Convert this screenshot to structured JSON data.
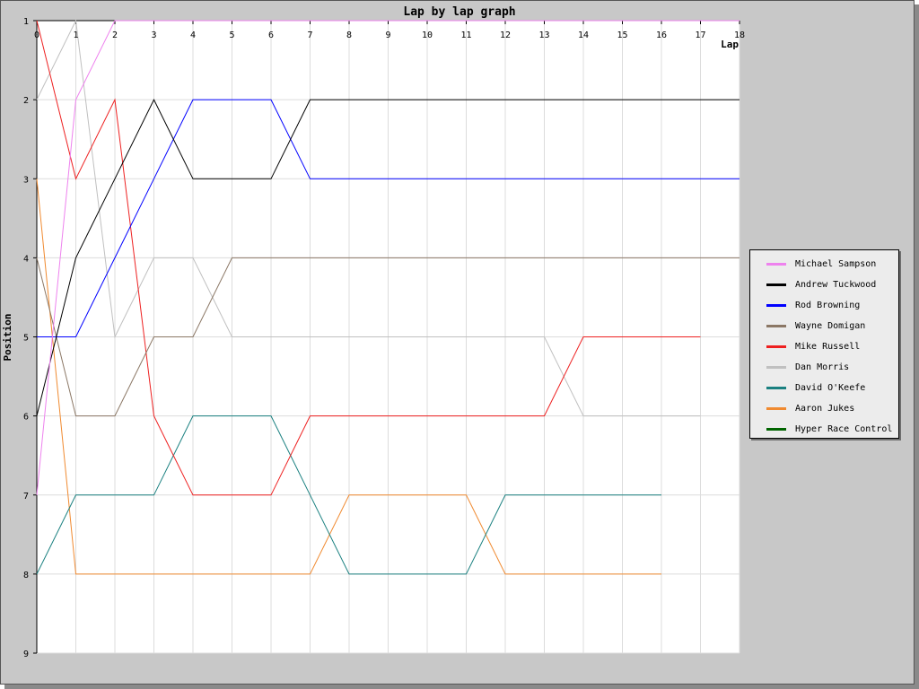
{
  "chart_data": {
    "type": "line",
    "title": "Lap by lap graph",
    "xlabel": "Lap",
    "ylabel": "Position",
    "xlim": [
      0,
      18
    ],
    "ylim": [
      1,
      9
    ],
    "y_inverted": true,
    "x_ticks": [
      0,
      1,
      2,
      3,
      4,
      5,
      6,
      7,
      8,
      9,
      10,
      11,
      12,
      13,
      14,
      15,
      16,
      17,
      18
    ],
    "y_ticks": [
      1,
      2,
      3,
      4,
      5,
      6,
      7,
      8,
      9
    ],
    "grid": true,
    "legend_position": "right",
    "series": [
      {
        "name": "Michael Sampson",
        "color": "#ee82ee",
        "x": [
          0,
          1,
          2,
          3,
          4,
          5,
          6,
          7,
          8,
          9,
          10,
          11,
          12,
          13,
          14,
          15,
          16,
          17,
          18
        ],
        "y": [
          7,
          2,
          1,
          1,
          1,
          1,
          1,
          1,
          1,
          1,
          1,
          1,
          1,
          1,
          1,
          1,
          1,
          1,
          1
        ]
      },
      {
        "name": "Andrew Tuckwood",
        "color": "#000000",
        "x": [
          0,
          1,
          2,
          3,
          4,
          5,
          6,
          7,
          8,
          9,
          10,
          11,
          12,
          13,
          14,
          15,
          16,
          17,
          18
        ],
        "y": [
          6,
          4,
          3,
          2,
          3,
          3,
          3,
          2,
          2,
          2,
          2,
          2,
          2,
          2,
          2,
          2,
          2,
          2,
          2
        ]
      },
      {
        "name": "Rod Browning",
        "color": "#0000ff",
        "x": [
          0,
          1,
          2,
          3,
          4,
          5,
          6,
          7,
          8,
          9,
          10,
          11,
          12,
          13,
          14,
          15,
          16,
          17,
          18
        ],
        "y": [
          5,
          5,
          4,
          3,
          2,
          2,
          2,
          3,
          3,
          3,
          3,
          3,
          3,
          3,
          3,
          3,
          3,
          3,
          3
        ]
      },
      {
        "name": "Wayne Domigan",
        "color": "#8b7765",
        "x": [
          0,
          1,
          2,
          3,
          4,
          5,
          6,
          7,
          8,
          9,
          10,
          11,
          12,
          13,
          14,
          15,
          16,
          17,
          18
        ],
        "y": [
          4,
          6,
          6,
          5,
          5,
          4,
          4,
          4,
          4,
          4,
          4,
          4,
          4,
          4,
          4,
          4,
          4,
          4,
          4
        ]
      },
      {
        "name": "Mike Russell",
        "color": "#ee2020",
        "x": [
          0,
          1,
          2,
          3,
          4,
          5,
          6,
          7,
          8,
          9,
          10,
          11,
          12,
          13,
          14,
          15,
          16,
          17
        ],
        "y": [
          1,
          3,
          2,
          6,
          7,
          7,
          7,
          6,
          6,
          6,
          6,
          6,
          6,
          6,
          5,
          5,
          5,
          5
        ]
      },
      {
        "name": "Dan Morris",
        "color": "#c0c0c0",
        "x": [
          0,
          1,
          2,
          3,
          4,
          5,
          6,
          7,
          8,
          9,
          10,
          11,
          12,
          13,
          14,
          15,
          16,
          17
        ],
        "y": [
          2,
          1,
          5,
          4,
          4,
          5,
          5,
          5,
          5,
          5,
          5,
          5,
          5,
          5,
          6,
          6,
          6,
          6
        ]
      },
      {
        "name": "David O'Keefe",
        "color": "#1a8080",
        "x": [
          0,
          1,
          2,
          3,
          4,
          5,
          6,
          7,
          8,
          9,
          10,
          11,
          12,
          13,
          14,
          15,
          16
        ],
        "y": [
          8,
          7,
          7,
          7,
          6,
          6,
          6,
          7,
          8,
          8,
          8,
          8,
          7,
          7,
          7,
          7,
          7
        ]
      },
      {
        "name": "Aaron Jukes",
        "color": "#f08a30",
        "x": [
          0,
          1,
          2,
          3,
          4,
          5,
          6,
          7,
          8,
          9,
          10,
          11,
          12,
          13,
          14,
          15,
          16
        ],
        "y": [
          3,
          8,
          8,
          8,
          8,
          8,
          8,
          8,
          7,
          7,
          7,
          7,
          8,
          8,
          8,
          8,
          8
        ]
      },
      {
        "name": "Hyper Race Control",
        "color": "#006400",
        "x": [],
        "y": []
      }
    ]
  }
}
